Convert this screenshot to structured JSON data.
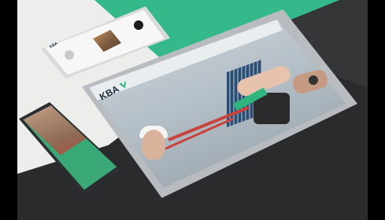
{
  "brand": {
    "name": "KBA"
  },
  "tablet": {
    "cta_label": "",
    "headline": ""
  },
  "phone_top": {
    "brand_label": "KBA"
  },
  "phone_left": {
    "body_text": ""
  },
  "colors": {
    "accent": "#35b98a",
    "light_bg": "#ededeb",
    "dark_bg": "#2a2b2c"
  },
  "icons": [
    "kba-logo-icon",
    "watch-icon"
  ]
}
